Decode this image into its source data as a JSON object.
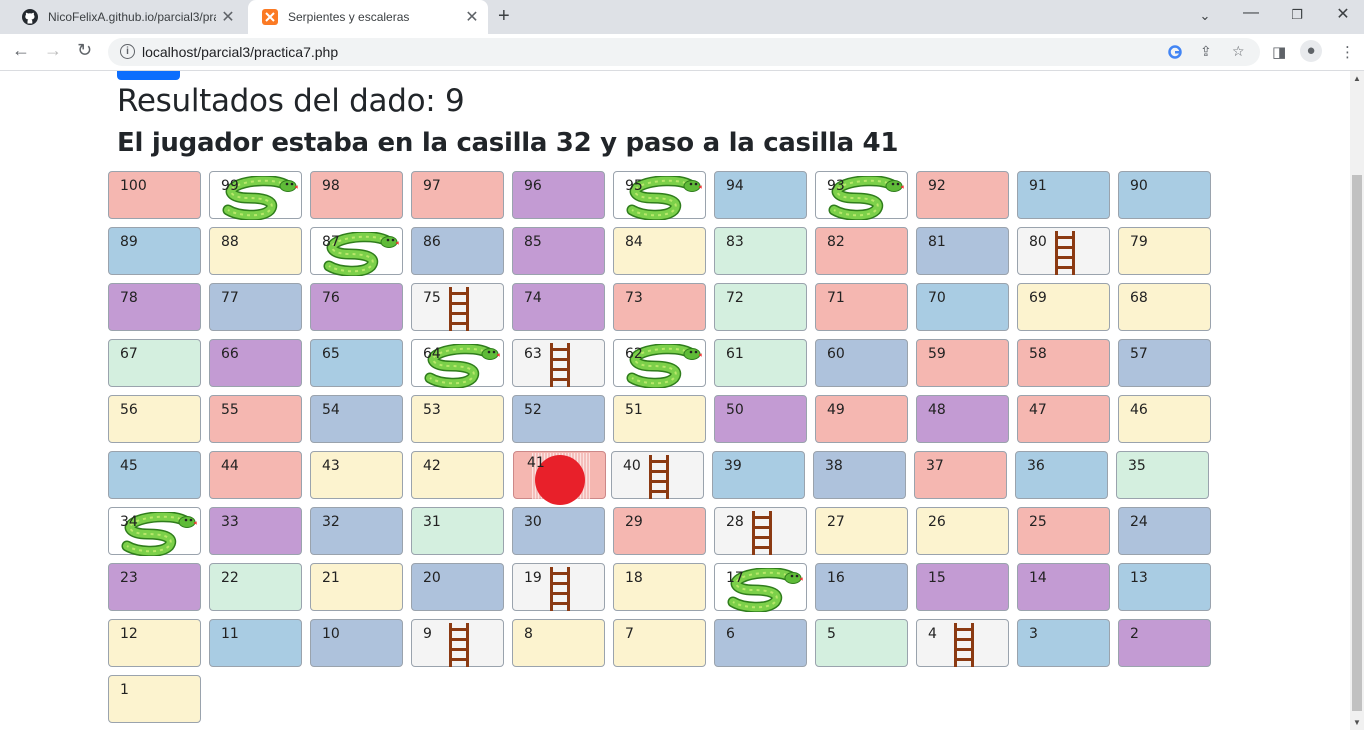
{
  "browser": {
    "tabs": [
      {
        "title": "NicoFelixA.github.io/parcial3/pra",
        "active": false
      },
      {
        "title": "Serpientes y escaleras",
        "active": true
      }
    ],
    "url": "localhost/parcial3/practica7.php"
  },
  "page": {
    "heading": "Resultados del dado: 9",
    "subheading": "El jugador estaba en la casilla 32 y paso a la casilla 41"
  },
  "board": {
    "current": 41,
    "snakes": [
      99,
      95,
      93,
      87,
      64,
      62,
      34,
      17
    ],
    "ladders": [
      80,
      75,
      63,
      40,
      28,
      19,
      9,
      4
    ],
    "rows": [
      [
        {
          "n": "100",
          "c": "red"
        },
        {
          "n": "99",
          "c": "snake"
        },
        {
          "n": "98",
          "c": "red"
        },
        {
          "n": "97",
          "c": "red"
        },
        {
          "n": "96",
          "c": "purple"
        },
        {
          "n": "95",
          "c": "snake"
        },
        {
          "n": "94",
          "c": "blue"
        },
        {
          "n": "93",
          "c": "snake"
        },
        {
          "n": "92",
          "c": "red"
        },
        {
          "n": "91",
          "c": "blue"
        },
        {
          "n": "90",
          "c": "blue"
        }
      ],
      [
        {
          "n": "89",
          "c": "blue"
        },
        {
          "n": "88",
          "c": "yellow"
        },
        {
          "n": "87",
          "c": "snake"
        },
        {
          "n": "86",
          "c": "steel"
        },
        {
          "n": "85",
          "c": "purple"
        },
        {
          "n": "84",
          "c": "yellow"
        },
        {
          "n": "83",
          "c": "green"
        },
        {
          "n": "82",
          "c": "red"
        },
        {
          "n": "81",
          "c": "steel"
        },
        {
          "n": "80",
          "c": "ladder"
        },
        {
          "n": "79",
          "c": "yellow"
        }
      ],
      [
        {
          "n": "78",
          "c": "purple"
        },
        {
          "n": "77",
          "c": "steel"
        },
        {
          "n": "76",
          "c": "purple"
        },
        {
          "n": "75",
          "c": "ladder"
        },
        {
          "n": "74",
          "c": "purple"
        },
        {
          "n": "73",
          "c": "red"
        },
        {
          "n": "72",
          "c": "green"
        },
        {
          "n": "71",
          "c": "red"
        },
        {
          "n": "70",
          "c": "blue"
        },
        {
          "n": "69",
          "c": "yellow"
        },
        {
          "n": "68",
          "c": "yellow"
        }
      ],
      [
        {
          "n": "67",
          "c": "green"
        },
        {
          "n": "66",
          "c": "purple"
        },
        {
          "n": "65",
          "c": "blue"
        },
        {
          "n": "64",
          "c": "snake"
        },
        {
          "n": "63",
          "c": "ladder"
        },
        {
          "n": "62",
          "c": "snake"
        },
        {
          "n": "61",
          "c": "green"
        },
        {
          "n": "60",
          "c": "steel"
        },
        {
          "n": "59",
          "c": "red"
        },
        {
          "n": "58",
          "c": "red"
        },
        {
          "n": "57",
          "c": "steel"
        }
      ],
      [
        {
          "n": "56",
          "c": "yellow"
        },
        {
          "n": "55",
          "c": "red"
        },
        {
          "n": "54",
          "c": "steel"
        },
        {
          "n": "53",
          "c": "yellow"
        },
        {
          "n": "52",
          "c": "steel"
        },
        {
          "n": "51",
          "c": "yellow"
        },
        {
          "n": "50",
          "c": "purple"
        },
        {
          "n": "49",
          "c": "red"
        },
        {
          "n": "48",
          "c": "purple"
        },
        {
          "n": "47",
          "c": "red"
        },
        {
          "n": "46",
          "c": "yellow"
        }
      ],
      [
        {
          "n": "45",
          "c": "blue"
        },
        {
          "n": "44",
          "c": "red"
        },
        {
          "n": "43",
          "c": "yellow"
        },
        {
          "n": "42",
          "c": "yellow"
        },
        {
          "n": "41",
          "c": "current"
        },
        {
          "n": "40",
          "c": "ladder"
        },
        {
          "n": "39",
          "c": "blue"
        },
        {
          "n": "38",
          "c": "steel"
        },
        {
          "n": "37",
          "c": "red"
        },
        {
          "n": "36",
          "c": "blue"
        },
        {
          "n": "35",
          "c": "green"
        }
      ],
      [
        {
          "n": "34",
          "c": "snake"
        },
        {
          "n": "33",
          "c": "purple"
        },
        {
          "n": "32",
          "c": "steel"
        },
        {
          "n": "31",
          "c": "green"
        },
        {
          "n": "30",
          "c": "steel"
        },
        {
          "n": "29",
          "c": "red"
        },
        {
          "n": "28",
          "c": "ladder"
        },
        {
          "n": "27",
          "c": "yellow"
        },
        {
          "n": "26",
          "c": "yellow"
        },
        {
          "n": "25",
          "c": "red"
        },
        {
          "n": "24",
          "c": "steel"
        }
      ],
      [
        {
          "n": "23",
          "c": "purple"
        },
        {
          "n": "22",
          "c": "green"
        },
        {
          "n": "21",
          "c": "yellow"
        },
        {
          "n": "20",
          "c": "steel"
        },
        {
          "n": "19",
          "c": "ladder"
        },
        {
          "n": "18",
          "c": "yellow"
        },
        {
          "n": "17",
          "c": "snake"
        },
        {
          "n": "16",
          "c": "steel"
        },
        {
          "n": "15",
          "c": "purple"
        },
        {
          "n": "14",
          "c": "purple"
        },
        {
          "n": "13",
          "c": "blue"
        }
      ],
      [
        {
          "n": "12",
          "c": "yellow"
        },
        {
          "n": "11",
          "c": "blue"
        },
        {
          "n": "10",
          "c": "steel"
        },
        {
          "n": "9",
          "c": "ladder"
        },
        {
          "n": "8",
          "c": "yellow"
        },
        {
          "n": "7",
          "c": "yellow"
        },
        {
          "n": "6",
          "c": "steel"
        },
        {
          "n": "5",
          "c": "green"
        },
        {
          "n": "4",
          "c": "ladder"
        },
        {
          "n": "3",
          "c": "blue"
        },
        {
          "n": "2",
          "c": "purple"
        }
      ],
      [
        {
          "n": "1",
          "c": "yellow"
        }
      ]
    ]
  },
  "colors": {
    "red": "#f5b7b1",
    "blue": "#a9cce3",
    "steel": "#aec2dc",
    "purple": "#c39bd3",
    "green": "#d4efdf",
    "yellow": "#fcf3cf",
    "token": "#e8202a",
    "snake": "#6cc24a",
    "ladder": "#8b3a12",
    "button": "#0d6efd"
  }
}
